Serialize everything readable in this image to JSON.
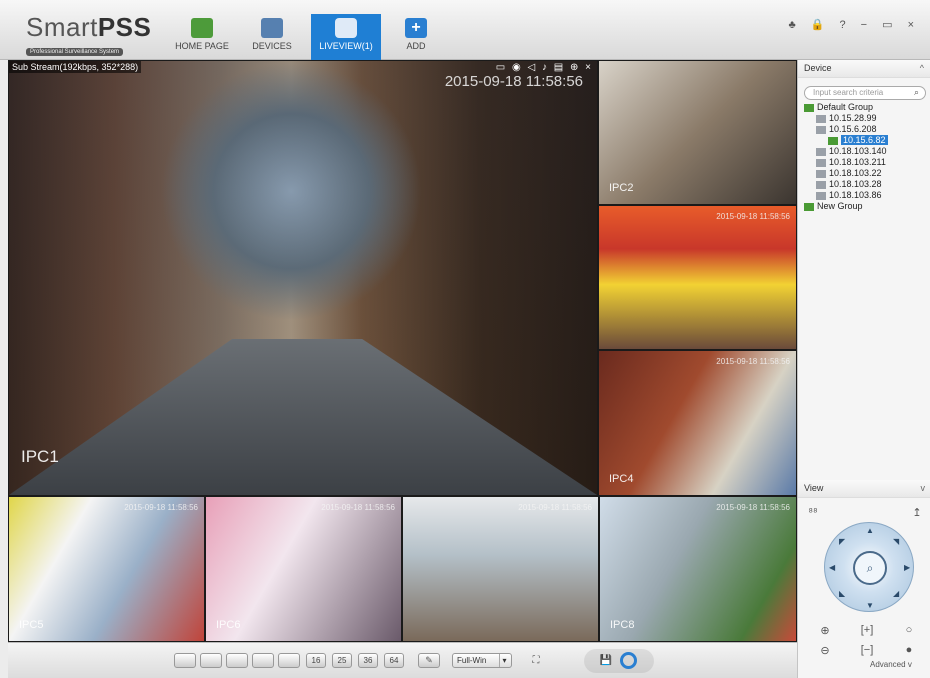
{
  "app": {
    "name_plain": "Smart",
    "name_bold": "PSS",
    "tagline": "Professional Surveillance System"
  },
  "nav": [
    {
      "id": "home",
      "label": "HOME PAGE",
      "icon": "home-icon"
    },
    {
      "id": "devices",
      "label": "DEVICES",
      "icon": "devices-icon"
    },
    {
      "id": "liveview",
      "label": "LIVEVIEW(1)",
      "icon": "liveview-icon"
    },
    {
      "id": "add",
      "label": "ADD",
      "icon": "add-icon"
    }
  ],
  "window_controls": "♣ 🔒 ? − ▭ ×",
  "main_view": {
    "stream_info": "Sub Stream(192kbps, 352*288)",
    "timestamp": "2015-09-18 11:58:56",
    "label": "IPC1",
    "toolbar": "▭ ◉ ◁ ♪ ▤ ⊕ ×"
  },
  "cells": [
    {
      "id": "2",
      "label": "IPC2",
      "timestamp": ""
    },
    {
      "id": "3",
      "label": "",
      "timestamp": "2015-09-18 11:58:56"
    },
    {
      "id": "4",
      "label": "IPC4",
      "timestamp": "2015-09-18 11:58:56"
    },
    {
      "id": "5",
      "label": "IPC5",
      "timestamp": "2015-09-18 11:58:56"
    },
    {
      "id": "6",
      "label": "IPC6",
      "timestamp": "2015-09-18 11:58:56"
    },
    {
      "id": "7",
      "label": "",
      "timestamp": "2015-09-18 11:58:56"
    },
    {
      "id": "8",
      "label": "IPC8",
      "timestamp": "2015-09-18 11:58:56"
    }
  ],
  "bottombar": {
    "layouts": [
      "",
      "",
      "",
      "",
      "",
      "16",
      "25",
      "36",
      "64"
    ],
    "edit": "✎",
    "fullwin": "Full-Win",
    "fullscreen": "⛶",
    "save": "💾"
  },
  "device_panel": {
    "title": "Device",
    "search_placeholder": "Input search criteria",
    "tree": [
      {
        "label": "Default Group",
        "type": "group",
        "indent": 0,
        "selected": false
      },
      {
        "label": "10.15.28.99",
        "type": "dev",
        "indent": 1,
        "selected": false
      },
      {
        "label": "10.15.6.208",
        "type": "dev",
        "indent": 1,
        "selected": false
      },
      {
        "label": "10.15.6.82",
        "type": "dev-on",
        "indent": 2,
        "selected": true
      },
      {
        "label": "10.18.103.140",
        "type": "dev",
        "indent": 1,
        "selected": false
      },
      {
        "label": "10.18.103.211",
        "type": "dev",
        "indent": 1,
        "selected": false
      },
      {
        "label": "10.18.103.22",
        "type": "dev",
        "indent": 1,
        "selected": false
      },
      {
        "label": "10.18.103.28",
        "type": "dev",
        "indent": 1,
        "selected": false
      },
      {
        "label": "10.18.103.86",
        "type": "dev",
        "indent": 1,
        "selected": false
      },
      {
        "label": "New Group",
        "type": "group",
        "indent": 0,
        "selected": false
      }
    ]
  },
  "view_panel": {
    "title": "View",
    "advanced": "Advanced"
  }
}
